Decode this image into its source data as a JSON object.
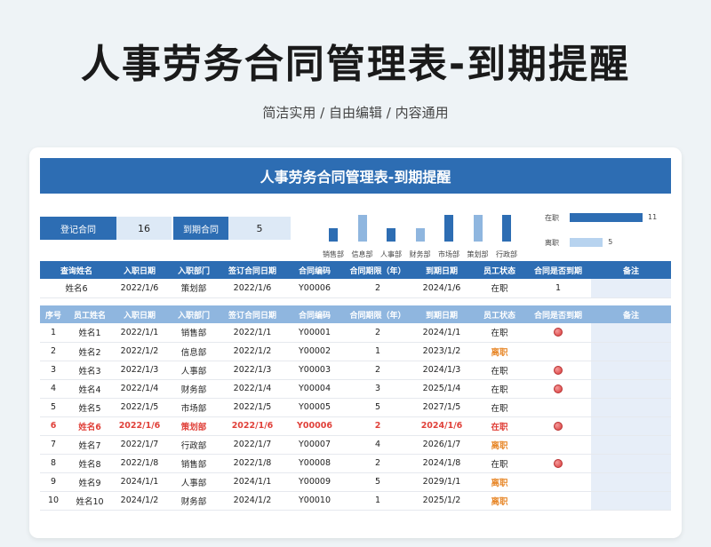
{
  "page": {
    "title": "人事劳务合同管理表-到期提醒",
    "subtitle": "简洁实用 / 自由编辑 / 内容通用"
  },
  "sheet": {
    "banner": "人事劳务合同管理表-到期提醒",
    "stats": {
      "registered_label": "登记合同",
      "registered_value": "16",
      "expiring_label": "到期合同",
      "expiring_value": "5"
    },
    "dept_chart": {
      "bars": [
        {
          "label": "销售部",
          "value": 3,
          "color": "#2d6db3"
        },
        {
          "label": "信息部",
          "value": 6,
          "color": "#8fb6df"
        },
        {
          "label": "人事部",
          "value": 3,
          "color": "#2d6db3"
        },
        {
          "label": "财务部",
          "value": 3,
          "color": "#8fb6df"
        },
        {
          "label": "市场部",
          "value": 6,
          "color": "#2d6db3"
        },
        {
          "label": "策划部",
          "value": 6,
          "color": "#8fb6df"
        },
        {
          "label": "行政部",
          "value": 6,
          "color": "#2d6db3"
        }
      ],
      "max": 6
    },
    "status_chart": {
      "rows": [
        {
          "label": "在职",
          "value": "11",
          "num": 11,
          "color": "#2d6db3"
        },
        {
          "label": "离职",
          "value": "5",
          "num": 5,
          "color": "#b7d3ef"
        }
      ],
      "max": 11
    },
    "query": {
      "headers": [
        "查询姓名",
        "入职日期",
        "入职部门",
        "签订合同日期",
        "合同编码",
        "合同期限（年）",
        "到期日期",
        "员工状态",
        "合同是否到期",
        "备注"
      ],
      "row": [
        "姓名6",
        "2022/1/6",
        "策划部",
        "2022/1/6",
        "Y00006",
        "2",
        "2024/1/6",
        "在职",
        "1",
        ""
      ]
    },
    "list": {
      "headers": [
        "序号",
        "员工姓名",
        "入职日期",
        "入职部门",
        "签订合同日期",
        "合同编码",
        "合同期限（年）",
        "到期日期",
        "员工状态",
        "合同是否到期",
        "备注"
      ],
      "rows": [
        {
          "cells": [
            "1",
            "姓名1",
            "2022/1/1",
            "销售部",
            "2022/1/1",
            "Y00001",
            "2",
            "2024/1/1",
            "在职"
          ],
          "expired": true,
          "left": false,
          "highlight": false
        },
        {
          "cells": [
            "2",
            "姓名2",
            "2022/1/2",
            "信息部",
            "2022/1/2",
            "Y00002",
            "1",
            "2023/1/2",
            "离职"
          ],
          "expired": false,
          "left": true,
          "highlight": false
        },
        {
          "cells": [
            "3",
            "姓名3",
            "2022/1/3",
            "人事部",
            "2022/1/3",
            "Y00003",
            "2",
            "2024/1/3",
            "在职"
          ],
          "expired": true,
          "left": false,
          "highlight": false
        },
        {
          "cells": [
            "4",
            "姓名4",
            "2022/1/4",
            "财务部",
            "2022/1/4",
            "Y00004",
            "3",
            "2025/1/4",
            "在职"
          ],
          "expired": true,
          "left": false,
          "highlight": false
        },
        {
          "cells": [
            "5",
            "姓名5",
            "2022/1/5",
            "市场部",
            "2022/1/5",
            "Y00005",
            "5",
            "2027/1/5",
            "在职"
          ],
          "expired": false,
          "left": false,
          "highlight": false
        },
        {
          "cells": [
            "6",
            "姓名6",
            "2022/1/6",
            "策划部",
            "2022/1/6",
            "Y00006",
            "2",
            "2024/1/6",
            "在职"
          ],
          "expired": true,
          "left": false,
          "highlight": true
        },
        {
          "cells": [
            "7",
            "姓名7",
            "2022/1/7",
            "行政部",
            "2022/1/7",
            "Y00007",
            "4",
            "2026/1/7",
            "离职"
          ],
          "expired": false,
          "left": true,
          "highlight": false
        },
        {
          "cells": [
            "8",
            "姓名8",
            "2022/1/8",
            "销售部",
            "2022/1/8",
            "Y00008",
            "2",
            "2024/1/8",
            "在职"
          ],
          "expired": true,
          "left": false,
          "highlight": false
        },
        {
          "cells": [
            "9",
            "姓名9",
            "2024/1/1",
            "人事部",
            "2024/1/1",
            "Y00009",
            "5",
            "2029/1/1",
            "离职"
          ],
          "expired": false,
          "left": true,
          "highlight": false
        },
        {
          "cells": [
            "10",
            "姓名10",
            "2024/1/2",
            "财务部",
            "2024/1/2",
            "Y00010",
            "1",
            "2025/1/2",
            "离职"
          ],
          "expired": false,
          "left": true,
          "highlight": false
        }
      ]
    }
  }
}
